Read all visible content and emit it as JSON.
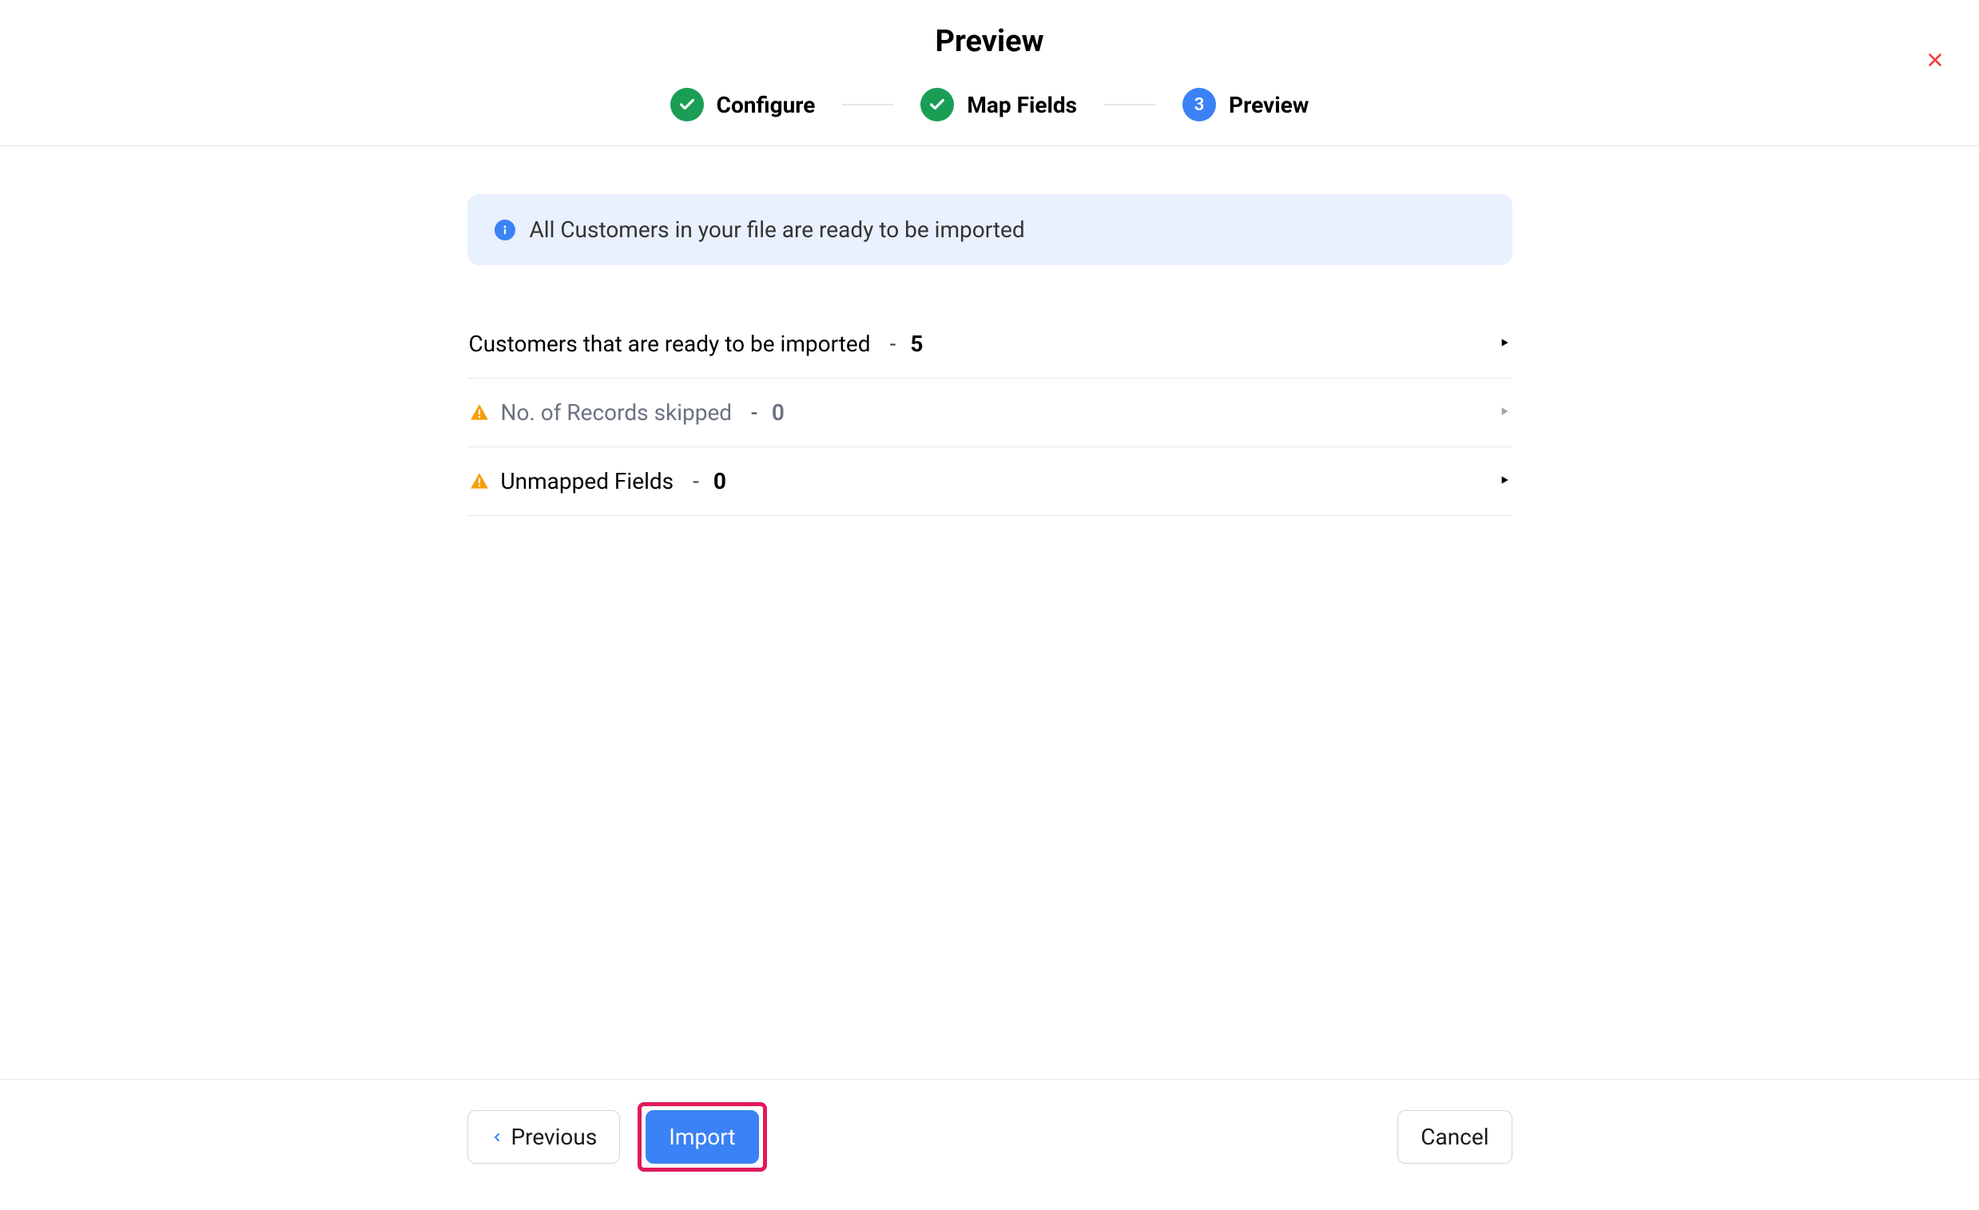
{
  "header": {
    "title": "Preview",
    "steps": [
      {
        "label": "Configure",
        "status": "done"
      },
      {
        "label": "Map Fields",
        "status": "done"
      },
      {
        "number": "3",
        "label": "Preview",
        "status": "current"
      }
    ]
  },
  "banner": {
    "message": "All Customers in your file are ready to be imported"
  },
  "rows": {
    "ready": {
      "label": "Customers that are ready to be imported",
      "count": "5"
    },
    "skipped": {
      "label": "No. of Records skipped",
      "count": "0"
    },
    "unmapped": {
      "label": "Unmapped Fields",
      "count": "0"
    }
  },
  "footer": {
    "previous": "Previous",
    "import": "Import",
    "cancel": "Cancel"
  }
}
